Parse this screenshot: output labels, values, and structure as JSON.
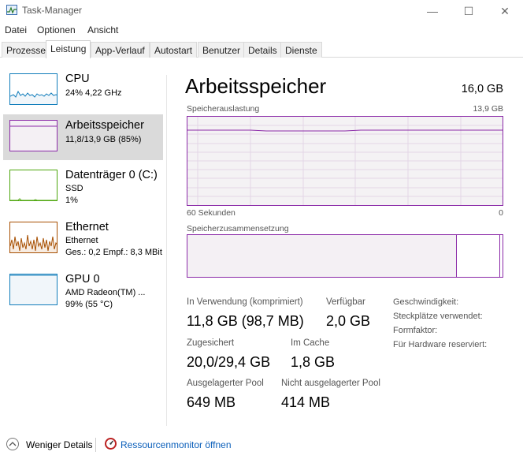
{
  "window": {
    "title": "Task-Manager",
    "minimize": "—",
    "maximize": "☐",
    "close": "✕"
  },
  "menu": [
    "Datei",
    "Optionen",
    "Ansicht"
  ],
  "tabs": [
    "Prozesse",
    "Leistung",
    "App-Verlauf",
    "Autostart",
    "Benutzer",
    "Details",
    "Dienste"
  ],
  "active_tab": "Leistung",
  "sidebar": {
    "items": [
      {
        "title": "CPU",
        "lines": [
          "24%  4,22 GHz"
        ],
        "color": "#117dbb"
      },
      {
        "title": "Arbeitsspeicher",
        "lines": [
          "11,8/13,9 GB (85%)"
        ],
        "color": "#8b2aa8",
        "selected": true
      },
      {
        "title": "Datenträger 0 (C:)",
        "lines": [
          "SSD",
          "1%"
        ],
        "color": "#4da60c"
      },
      {
        "title": "Ethernet",
        "lines": [
          "Ethernet",
          "Ges.: 0,2  Empf.: 8,3 MBit"
        ],
        "color": "#a74f01"
      },
      {
        "title": "GPU 0",
        "lines": [
          "AMD Radeon(TM) ...",
          "99%  (55 °C)"
        ],
        "color": "#117dbb"
      }
    ]
  },
  "main": {
    "title": "Arbeitsspeicher",
    "total": "16,0 GB",
    "usage_label": "Speicherauslastung",
    "usage_max": "13,9 GB",
    "time_left": "60 Sekunden",
    "time_right": "0",
    "composition_label": "Speicherzusammensetzung",
    "usage_fraction": 0.85,
    "composition": {
      "used_fraction": 0.856,
      "standby_fraction": 0.99
    }
  },
  "stats": {
    "in_use_label": "In Verwendung (komprimiert)",
    "in_use_value": "11,8 GB (98,7 MB)",
    "available_label": "Verfügbar",
    "available_value": "2,0 GB",
    "committed_label": "Zugesichert",
    "committed_value": "20,0/29,4 GB",
    "cached_label": "Im Cache",
    "cached_value": "1,8 GB",
    "paged_label": "Ausgelagerter Pool",
    "paged_value": "649 MB",
    "nonpaged_label": "Nicht ausgelagerter Pool",
    "nonpaged_value": "414 MB"
  },
  "specs": [
    "Geschwindigkeit:",
    "Steckplätze verwendet:",
    "Formfaktor:",
    "Für Hardware reserviert:"
  ],
  "footer": {
    "fewer_details": "Weniger Details",
    "resource_monitor": "Ressourcenmonitor öffnen"
  }
}
